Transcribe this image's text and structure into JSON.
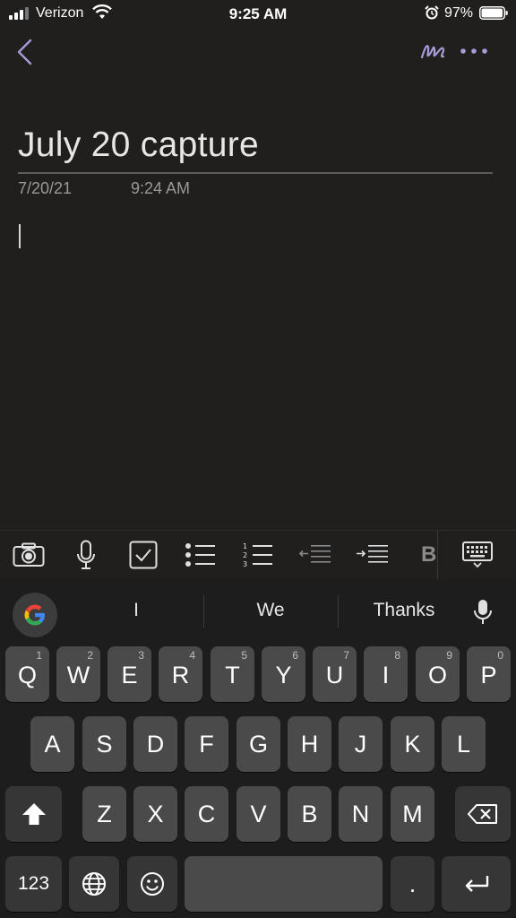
{
  "status_bar": {
    "carrier": "Verizon",
    "time": "9:25 AM",
    "battery_percent": "97%"
  },
  "note": {
    "title": "July 20 capture",
    "date": "7/20/21",
    "time": "9:24 AM"
  },
  "icons": {
    "back": "chevron-left-icon",
    "pen": "pen-icon",
    "more": "more-icon",
    "camera": "camera-icon",
    "mic": "microphone-icon",
    "checkbox": "checkbox-icon",
    "bullets": "bulleted-list-icon",
    "numbered": "numbered-list-icon",
    "outdent": "outdent-icon",
    "indent": "indent-icon",
    "bold": "bold-icon",
    "keyboard_hide": "keyboard-hide-icon"
  },
  "keyboard": {
    "suggestions": [
      "I",
      "We",
      "Thanks"
    ],
    "row1": [
      {
        "letter": "Q",
        "num": "1"
      },
      {
        "letter": "W",
        "num": "2"
      },
      {
        "letter": "E",
        "num": "3"
      },
      {
        "letter": "R",
        "num": "4"
      },
      {
        "letter": "T",
        "num": "5"
      },
      {
        "letter": "Y",
        "num": "6"
      },
      {
        "letter": "U",
        "num": "7"
      },
      {
        "letter": "I",
        "num": "8"
      },
      {
        "letter": "O",
        "num": "9"
      },
      {
        "letter": "P",
        "num": "0"
      }
    ],
    "row2": [
      "A",
      "S",
      "D",
      "F",
      "G",
      "H",
      "J",
      "K",
      "L"
    ],
    "row3": [
      "Z",
      "X",
      "C",
      "V",
      "B",
      "N",
      "M"
    ],
    "numbers_label": "123",
    "period_label": "."
  },
  "colors": {
    "accent_purple": "#a99ad8",
    "background": "#201f1e",
    "key": "#4a4a4a",
    "key_dark": "#363636"
  }
}
